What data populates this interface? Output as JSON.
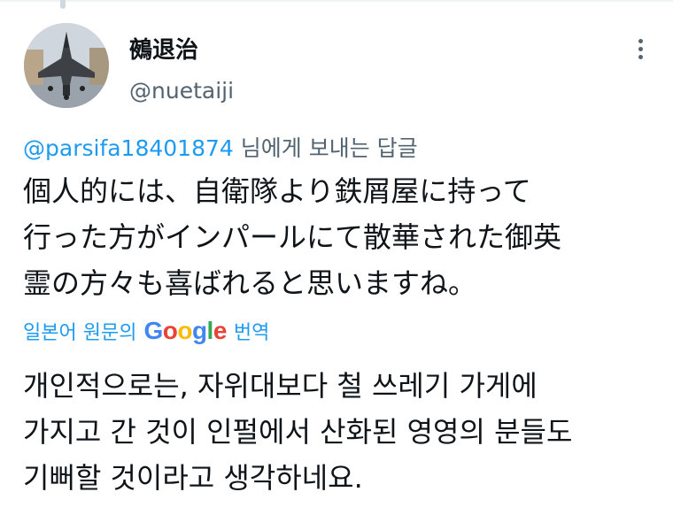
{
  "tweet": {
    "display_name": "鵺退治",
    "handle": "@nuetaiji",
    "reply_to_mention": "@parsifa18401874",
    "reply_suffix": " 님에게 보내는 답글",
    "original_lines": [
      "個人的には、自衛隊より鉄屑屋に持って",
      "行った方がインパールにて散華された御英",
      "霊の方々も喜ばれると思いますね。"
    ],
    "translate_prefix": "일본어 원문의",
    "translate_brand": "Google",
    "translate_suffix": "번역",
    "translated_lines": [
      "개인적으로는, 자위대보다 철 쓰레기 가게에",
      "가지고 간 것이 인펄에서 산화된 영영의 분들도",
      "기뻐할 것이라고 생각하네요."
    ]
  },
  "icons": {
    "avatar": "fighter-jet-avatar",
    "more": "more-options-icon"
  },
  "colors": {
    "link": "#1d9bf0",
    "secondary": "#536471",
    "primary": "#0f1419"
  }
}
